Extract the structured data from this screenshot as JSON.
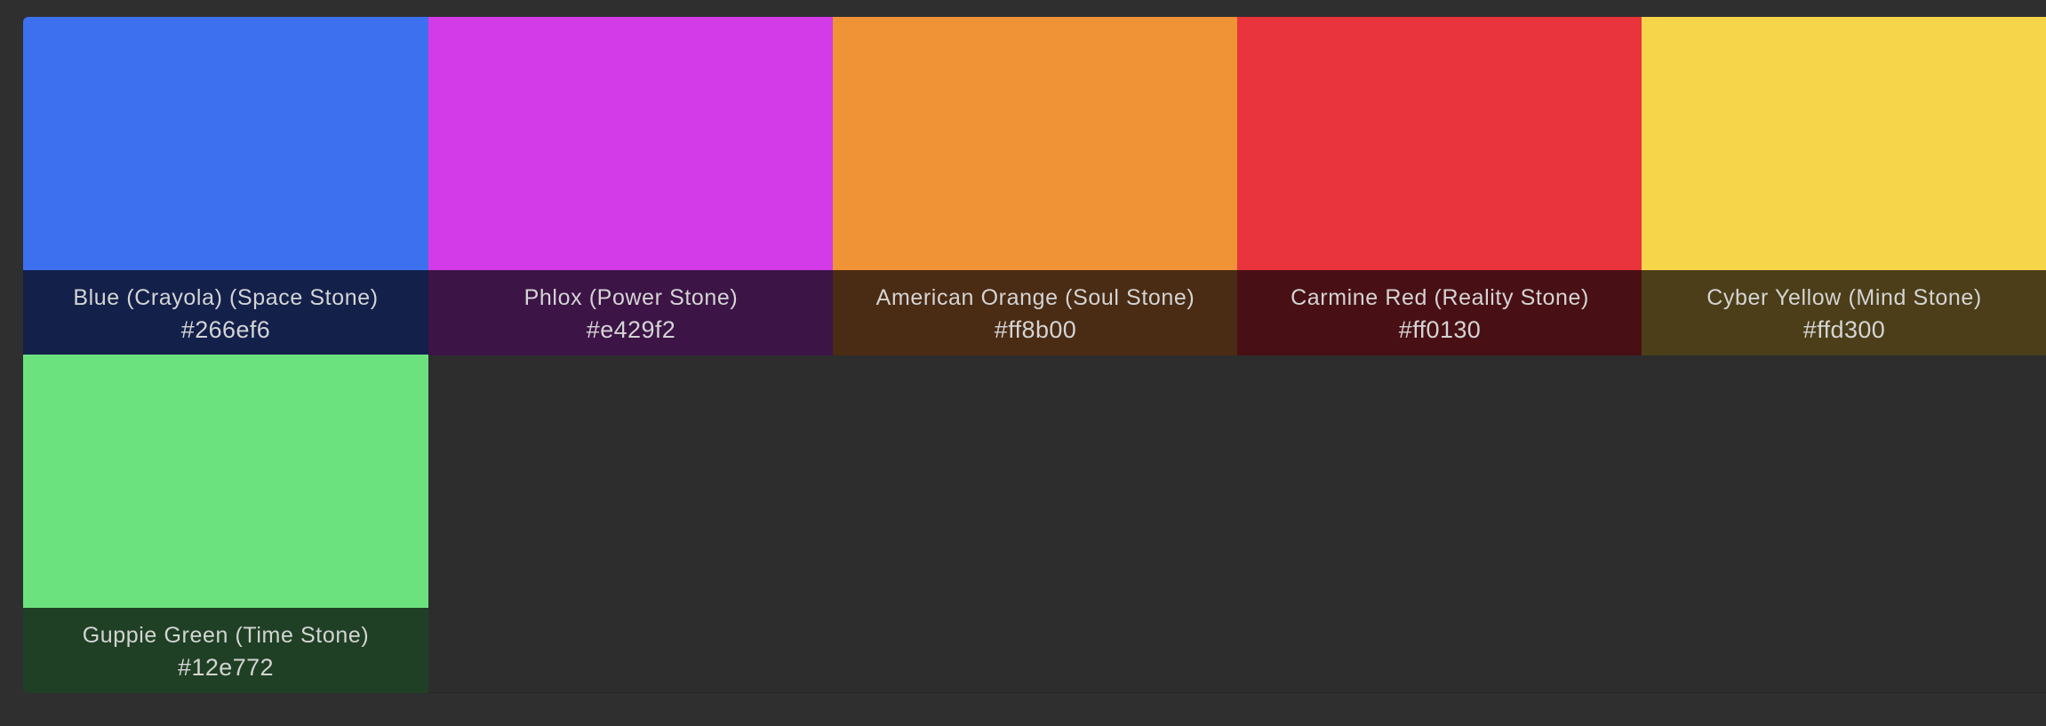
{
  "swatches": [
    {
      "name": "Blue (Crayola) (Space Stone)",
      "hex": "#266ef6",
      "chip_color": "#3d70ee",
      "label_bg": "#13204a"
    },
    {
      "name": "Phlox (Power Stone)",
      "hex": "#e429f2",
      "chip_color": "#d43be8",
      "label_bg": "#3c1446"
    },
    {
      "name": "American Orange (Soul Stone)",
      "hex": "#ff8b00",
      "chip_color": "#f09236",
      "label_bg": "#4a2b13"
    },
    {
      "name": "Carmine Red (Reality Stone)",
      "hex": "#ff0130",
      "chip_color": "#e9333d",
      "label_bg": "#481015"
    },
    {
      "name": "Cyber Yellow (Mind Stone)",
      "hex": "#ffd300",
      "chip_color": "#f7d54b",
      "label_bg": "#4b3e18"
    },
    {
      "name": "Guppie Green (Time Stone)",
      "hex": "#12e772",
      "chip_color": "#6ce27f",
      "label_bg": "#1f4024"
    }
  ]
}
